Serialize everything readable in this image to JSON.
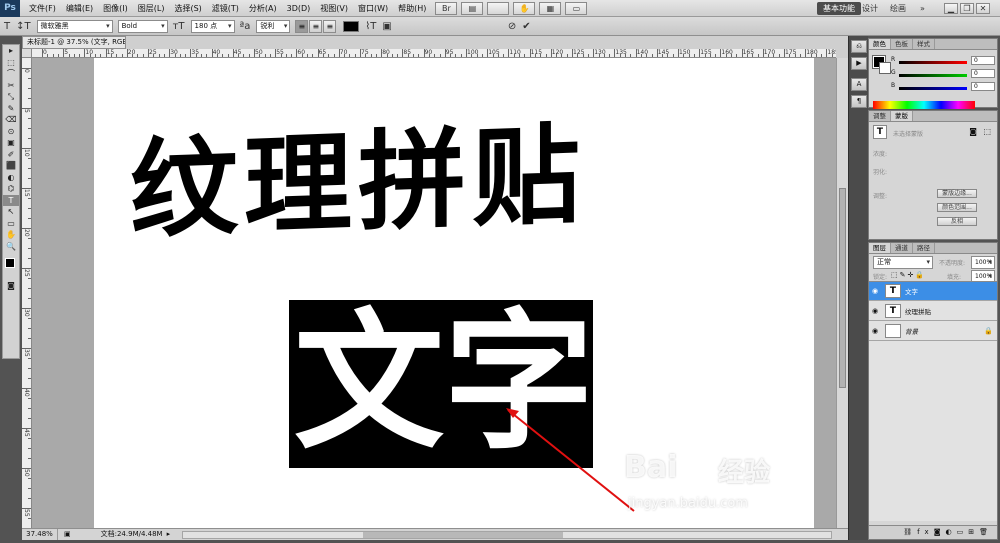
{
  "app": {
    "logo": "Ps"
  },
  "menu": {
    "items": [
      "文件(F)",
      "编辑(E)",
      "图像(I)",
      "图层(L)",
      "选择(S)",
      "滤镜(T)",
      "分析(A)",
      "3D(D)",
      "视图(V)",
      "窗口(W)",
      "帮助(H)"
    ],
    "zoom_select": "",
    "workspace": {
      "active": "基本功能",
      "design": "设计",
      "painting": "绘画"
    }
  },
  "options": {
    "font_family": "微软雅黑",
    "font_style": "Bold",
    "font_size": "180 点",
    "antialias": "锐利",
    "text_color": "#000000"
  },
  "tools": [
    "▸",
    "⬚",
    "⌒",
    "✂",
    "⤡",
    "✎",
    "⌫",
    "⊙",
    "▣",
    "✐",
    "⬛",
    "◐",
    "⌬",
    "T",
    "↖",
    "▭",
    "✋",
    "🔍"
  ],
  "document": {
    "tab_title": "未标题-1 @ 37.5% (文字, RGB/8) *",
    "ruler_top": [
      "0",
      "5",
      "10",
      "15",
      "20",
      "25",
      "30",
      "35",
      "40",
      "45",
      "50",
      "55",
      "60",
      "65",
      "70",
      "75",
      "80",
      "85",
      "90",
      "95",
      "100",
      "105",
      "110",
      "115",
      "120",
      "125",
      "130",
      "135",
      "140",
      "145",
      "150",
      "155",
      "160",
      "165",
      "170",
      "175",
      "180",
      "185",
      "190"
    ],
    "ruler_left": [
      "0",
      "5",
      "10",
      "15",
      "20",
      "25",
      "30",
      "35",
      "40",
      "45",
      "50",
      "55"
    ],
    "canvas_text_1": "纹理拼贴",
    "canvas_text_2": "文字",
    "zoom_level": "37.48%",
    "doc_size": "文档:24.9M/4.48M"
  },
  "watermark": {
    "brand": "Bai",
    "brand_suffix": "经验",
    "url": "jingyan.baidu.com"
  },
  "color_panel": {
    "tabs": [
      "颜色",
      "色板",
      "样式"
    ],
    "r": {
      "label": "R",
      "value": "0"
    },
    "g": {
      "label": "G",
      "value": "0"
    },
    "b": {
      "label": "B",
      "value": "0"
    }
  },
  "adjust_panel": {
    "tabs": [
      "调整",
      "蒙版"
    ],
    "no_mask": "未选择蒙版",
    "density_label": "浓度:",
    "feather_label": "羽化:",
    "refine_label": "调整:",
    "btn_edge": "蒙版边缘...",
    "btn_color_range": "颜色范围...",
    "btn_invert": "反相"
  },
  "layers_panel": {
    "tabs": [
      "图层",
      "通道",
      "路径"
    ],
    "blend_mode": "正常",
    "opacity_label": "不透明度:",
    "opacity": "100%",
    "lock_label": "锁定:",
    "fill_label": "填充:",
    "fill": "100%",
    "layers": [
      {
        "name": "文字",
        "thumb": "T",
        "active": true
      },
      {
        "name": "纹理拼贴",
        "thumb": "T",
        "active": false
      },
      {
        "name": "背景",
        "thumb": "",
        "active": false,
        "locked": true
      }
    ]
  }
}
